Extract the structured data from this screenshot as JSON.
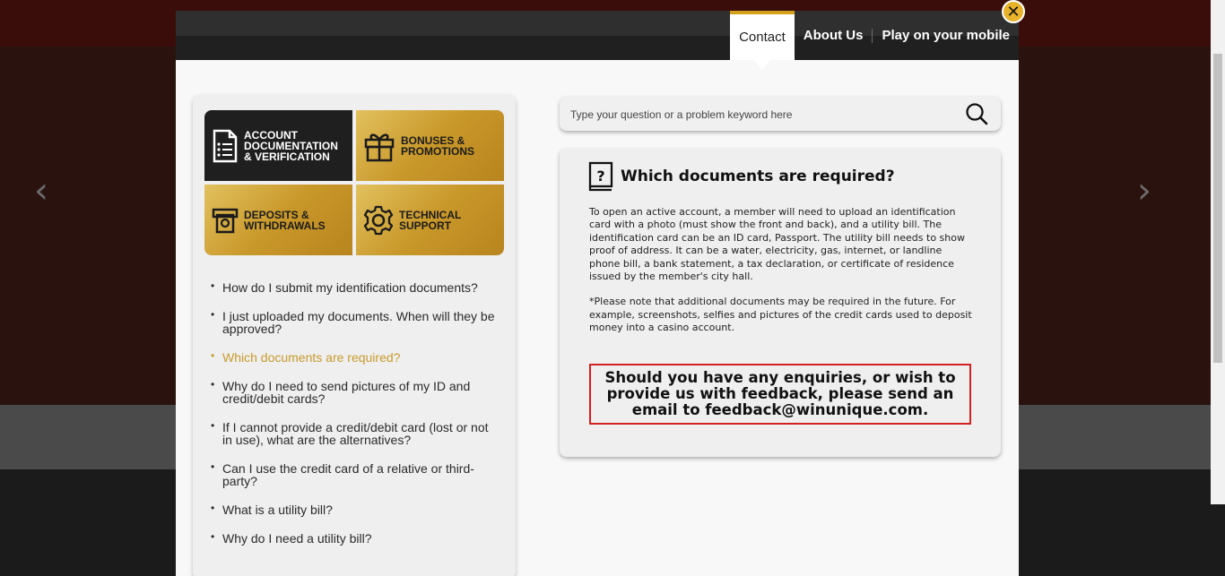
{
  "nav": {
    "contact": "Contact",
    "about": "About Us",
    "mobile": "Play on your mobile"
  },
  "close_icon": "close-icon",
  "categories": [
    {
      "label": "Account\nDocumentation\n& Verification",
      "icon": "document-list-icon",
      "selected": true
    },
    {
      "label": "Bonuses &\nPromotions",
      "icon": "gift-icon",
      "selected": false
    },
    {
      "label": "Deposits &\nWithdrawals",
      "icon": "atm-cash-icon",
      "selected": false
    },
    {
      "label": "Technical\nSupport",
      "icon": "gear-icon",
      "selected": false
    }
  ],
  "faq": [
    {
      "text": "How do I submit my identification documents?",
      "active": false
    },
    {
      "text": "I just uploaded my documents. When will they be approved?",
      "active": false
    },
    {
      "text": "Which documents are required?",
      "active": true
    },
    {
      "text": "Why do I need to send pictures of my ID and credit/debit cards?",
      "active": false
    },
    {
      "text": "If I cannot provide a credit/debit card (lost or not in use), what are the alternatives?",
      "active": false
    },
    {
      "text": "Can I use the credit card of a relative or third-party?",
      "active": false
    },
    {
      "text": "What is a utility bill?",
      "active": false
    },
    {
      "text": "Why do I need a utility bill?",
      "active": false
    }
  ],
  "search": {
    "placeholder": "Type your question or a problem keyword here",
    "icon": "search-icon"
  },
  "answer": {
    "icon": "question-book-icon",
    "title": "Which documents are required?",
    "paragraph1": "To open an active account, a member will need to upload an identification card with a photo (must show the front and back), and a utility bill. The identification card can be an ID card, Passport. The utility bill needs to show proof of address. It can be a water, electricity, gas, internet, or landline phone bill, a bank statement, a tax declaration, or certificate of residence issued by the member's city hall.",
    "paragraph2": "*Please note that additional documents may be required in the future. For example, screenshots, selfies and pictures of the credit cards used to deposit money into a casino account.",
    "enquiry": "Should you have any enquiries, or wish to provide us with feedback, please send an email to feedback@winunique.com."
  },
  "colors": {
    "accent_gold": "#c79a2c",
    "header_dark": "#202020",
    "enquiry_border": "#d32020"
  }
}
